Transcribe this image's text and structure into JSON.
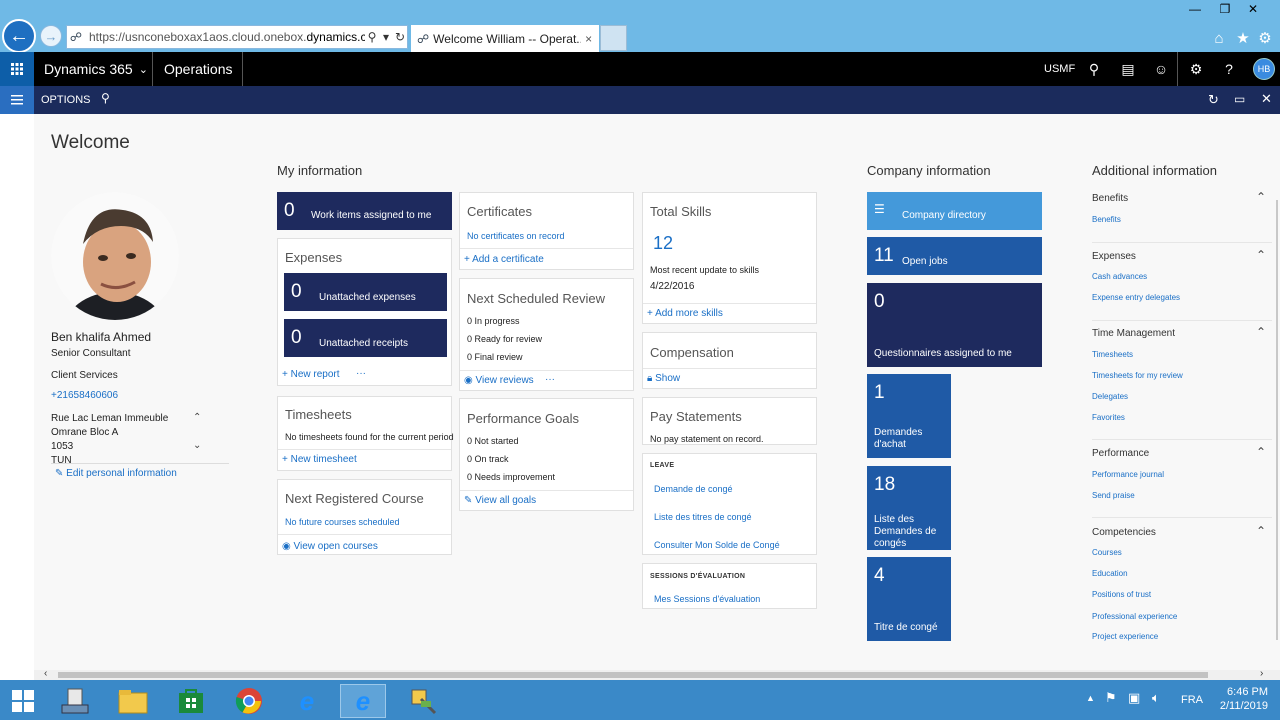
{
  "browser": {
    "url_prefix": "https://usnconeboxax1aos.cloud.onebox.",
    "url_domain": "dynamics.c...",
    "tab_title": "Welcome William -- Operat...",
    "tab_close": "×"
  },
  "topbar": {
    "app_name": "Dynamics 365",
    "module": "Operations",
    "company": "USMF",
    "avatar": "HB"
  },
  "optbar": {
    "options": "OPTIONS"
  },
  "page": {
    "title": "Welcome"
  },
  "profile": {
    "name": "Ben khalifa Ahmed",
    "title": "Senior Consultant",
    "department": "Client Services",
    "phone": "+21658460606",
    "address_line1": "Rue Lac Leman Immeuble",
    "address_line2": "Omrane Bloc A",
    "address_line3": "1053",
    "address_line4": "TUN",
    "edit_link": "Edit personal information"
  },
  "my_info": {
    "heading": "My information",
    "work_items": {
      "count": "0",
      "label": "Work items assigned to me"
    },
    "expenses": {
      "title": "Expenses",
      "unattached_expenses": {
        "count": "0",
        "label": "Unattached expenses"
      },
      "unattached_receipts": {
        "count": "0",
        "label": "Unattached receipts"
      },
      "new_report": "New report",
      "more": "···"
    },
    "timesheets": {
      "title": "Timesheets",
      "empty": "No timesheets found for the current period",
      "new": "New timesheet"
    },
    "registered_course": {
      "title": "Next Registered Course",
      "empty": "No future courses scheduled",
      "view": "View open courses"
    },
    "certificates": {
      "title": "Certificates",
      "empty": "No certificates on record",
      "add": "Add a certificate"
    },
    "review": {
      "title": "Next Scheduled Review",
      "lines": [
        "0 In progress",
        "0 Ready for review",
        "0 Final review"
      ],
      "view": "View reviews",
      "more": "···"
    },
    "goals": {
      "title": "Performance Goals",
      "lines": [
        "0 Not started",
        "0 On track",
        "0 Needs improvement"
      ],
      "view": "View all goals"
    },
    "skills": {
      "title": "Total Skills",
      "count": "12",
      "recent_label": "Most recent update to skills",
      "recent_date": "4/22/2016",
      "add": "Add more skills"
    },
    "compensation": {
      "title": "Compensation",
      "show": "Show"
    },
    "pay": {
      "title": "Pay Statements",
      "empty": "No pay statement on record."
    },
    "leave": {
      "heading": "LEAVE",
      "links": [
        "Demande de congé",
        "Liste des titres de congé",
        "Consulter Mon Solde de Congé"
      ]
    },
    "sessions": {
      "heading": "SESSIONS D'ÉVALUATION",
      "link": "Mes Sessions d'évaluation"
    }
  },
  "company_info": {
    "heading": "Company information",
    "directory": "Company directory",
    "open_jobs": {
      "count": "11",
      "label": "Open jobs"
    },
    "questionnaires": {
      "count": "0",
      "label": "Questionnaires assigned to me"
    },
    "demandes_achat": {
      "count": "1",
      "label1": "Demandes",
      "label2": "d'achat"
    },
    "liste_demandes": {
      "count": "18",
      "label1": "Liste des",
      "label2": "Demandes de",
      "label3": "congés"
    },
    "titre_conge": {
      "count": "4",
      "label": "Titre de congé"
    }
  },
  "additional": {
    "heading": "Additional information",
    "groups": [
      {
        "title": "Benefits",
        "links": [
          "Benefits"
        ]
      },
      {
        "title": "Expenses",
        "links": [
          "Cash advances",
          "Expense entry delegates"
        ]
      },
      {
        "title": "Time Management",
        "links": [
          "Timesheets",
          "Timesheets for my review",
          "Delegates",
          "Favorites"
        ]
      },
      {
        "title": "Performance",
        "links": [
          "Performance journal",
          "Send praise"
        ]
      },
      {
        "title": "Competencies",
        "links": [
          "Courses",
          "Education",
          "Positions of trust",
          "Professional experience",
          "Project experience"
        ]
      }
    ]
  },
  "taskbar": {
    "lang": "FRA",
    "time": "6:46 PM",
    "date": "2/11/2019"
  },
  "colors": {
    "chrome": "#6fb9e6",
    "navy": "#1e2a5e",
    "tile_blue": "#1f5aa6",
    "tile_light": "#4499da",
    "link": "#1a6fc6",
    "taskbar": "#3a89c8"
  }
}
